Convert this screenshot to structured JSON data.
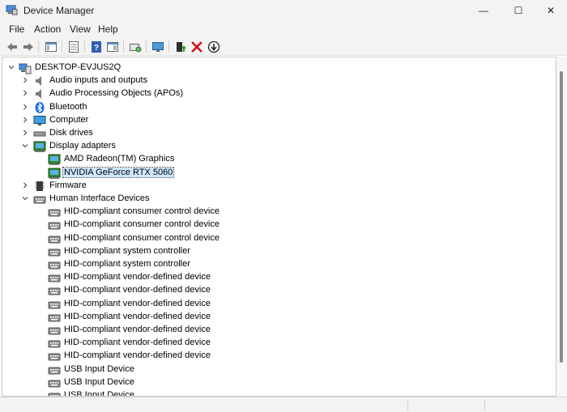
{
  "window": {
    "title": "Device Manager",
    "min_glyph": "—",
    "max_glyph": "☐",
    "close_glyph": "✕"
  },
  "menu": {
    "file": "File",
    "action": "Action",
    "view": "View",
    "help": "Help"
  },
  "toolbar": {
    "icons": [
      "back-icon",
      "forward-icon",
      "show-hide-tree-icon",
      "properties-icon",
      "help-icon",
      "action-pane-icon",
      "scan-hardware-icon",
      "computer-display-icon",
      "update-driver-icon",
      "uninstall-icon",
      "disable-device-icon"
    ]
  },
  "tree": {
    "root": "DESKTOP-EVJUS2Q",
    "categories": [
      {
        "label": "Audio inputs and outputs",
        "expanded": false,
        "icon": "speaker-icon"
      },
      {
        "label": "Audio Processing Objects (APOs)",
        "expanded": false,
        "icon": "speaker-icon"
      },
      {
        "label": "Bluetooth",
        "expanded": false,
        "icon": "bluetooth-icon"
      },
      {
        "label": "Computer",
        "expanded": false,
        "icon": "monitor-icon"
      },
      {
        "label": "Disk drives",
        "expanded": false,
        "icon": "disk-drive-icon"
      },
      {
        "label": "Display adapters",
        "expanded": true,
        "icon": "display-adapter-icon",
        "children": [
          "AMD Radeon(TM) Graphics",
          "NVIDIA GeForce RTX 5060"
        ]
      },
      {
        "label": "Firmware",
        "expanded": false,
        "icon": "firmware-icon"
      },
      {
        "label": "Human Interface Devices",
        "expanded": true,
        "icon": "hid-icon",
        "children": [
          "HID-compliant consumer control device",
          "HID-compliant consumer control device",
          "HID-compliant consumer control device",
          "HID-compliant system controller",
          "HID-compliant system controller",
          "HID-compliant vendor-defined device",
          "HID-compliant vendor-defined device",
          "HID-compliant vendor-defined device",
          "HID-compliant vendor-defined device",
          "HID-compliant vendor-defined device",
          "HID-compliant vendor-defined device",
          "HID-compliant vendor-defined device",
          "USB Input Device",
          "USB Input Device",
          "USB Input Device"
        ]
      }
    ],
    "selected": "NVIDIA GeForce RTX 5060"
  }
}
